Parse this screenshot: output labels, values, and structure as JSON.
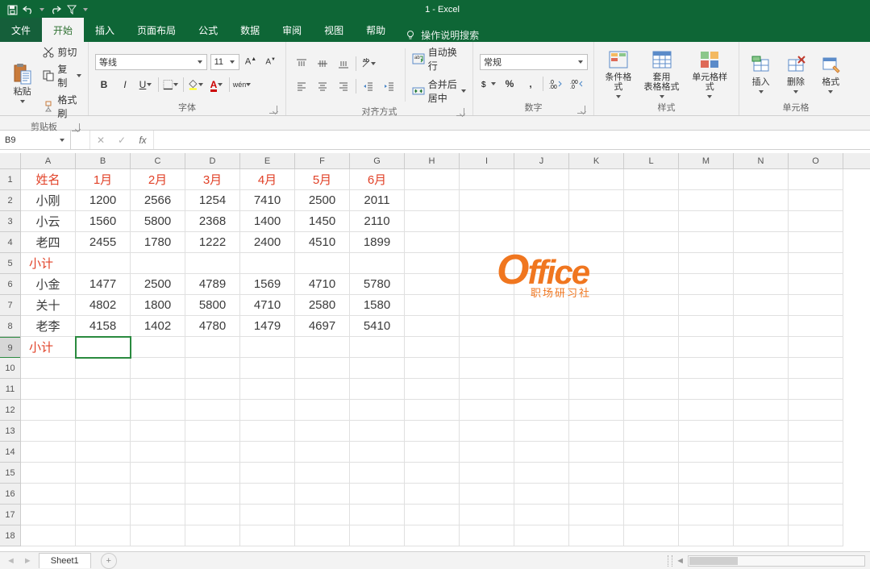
{
  "app": {
    "title": "1  -  Excel"
  },
  "qat": {
    "save": "save-icon",
    "undo": "undo-icon",
    "redo": "redo-icon",
    "filter": "funnel-icon"
  },
  "tabs": {
    "file": "文件",
    "home": "开始",
    "insert": "插入",
    "layout": "页面布局",
    "formulas": "公式",
    "data": "数据",
    "review": "审阅",
    "view": "视图",
    "help": "帮助",
    "tellme": "操作说明搜索"
  },
  "ribbon": {
    "clipboard": {
      "paste": "粘贴",
      "cut": "剪切",
      "copy": "复制",
      "painter": "格式刷",
      "label": "剪贴板"
    },
    "font": {
      "name": "等线",
      "size": "11",
      "label": "字体"
    },
    "align": {
      "wrap": "自动换行",
      "merge": "合并后居中",
      "label": "对齐方式"
    },
    "number": {
      "format": "常规",
      "label": "数字"
    },
    "styles": {
      "cond": "条件格式",
      "table": "套用\n表格格式",
      "cell": "单元格样式",
      "label": "样式"
    },
    "cells": {
      "insert": "插入",
      "delete": "删除",
      "format": "格式",
      "label": "单元格"
    }
  },
  "namebox": "B9",
  "columns": [
    "A",
    "B",
    "C",
    "D",
    "E",
    "F",
    "G",
    "H",
    "I",
    "J",
    "K",
    "L",
    "M",
    "N",
    "O"
  ],
  "row_numbers": [
    1,
    2,
    3,
    4,
    5,
    6,
    7,
    8,
    9,
    10,
    11,
    12,
    13,
    14,
    15,
    16,
    17,
    18
  ],
  "selected_cell": "B9",
  "table": {
    "headers": [
      "姓名",
      "1月",
      "2月",
      "3月",
      "4月",
      "5月",
      "6月"
    ],
    "rows": [
      [
        "小刚",
        1200,
        2566,
        1254,
        7410,
        2500,
        2011
      ],
      [
        "小云",
        1560,
        5800,
        2368,
        1400,
        1450,
        2110
      ],
      [
        "老四",
        2455,
        1780,
        1222,
        2400,
        4510,
        1899
      ],
      [
        "小计",
        "",
        "",
        "",
        "",
        "",
        ""
      ],
      [
        "小金",
        1477,
        2500,
        4789,
        1569,
        4710,
        5780
      ],
      [
        "关十",
        4802,
        1800,
        5800,
        4710,
        2580,
        1580
      ],
      [
        "老李",
        4158,
        1402,
        4780,
        1479,
        4697,
        5410
      ],
      [
        "小计",
        "",
        "",
        "",
        "",
        "",
        ""
      ]
    ],
    "subtotal_rows": [
      3,
      7
    ]
  },
  "sheet": {
    "name": "Sheet1"
  },
  "watermark": {
    "big": "Office",
    "small": "职场研习社"
  },
  "chart_data": {
    "type": "table",
    "title": "",
    "columns": [
      "姓名",
      "1月",
      "2月",
      "3月",
      "4月",
      "5月",
      "6月"
    ],
    "rows": [
      {
        "姓名": "小刚",
        "1月": 1200,
        "2月": 2566,
        "3月": 1254,
        "4月": 7410,
        "5月": 2500,
        "6月": 2011
      },
      {
        "姓名": "小云",
        "1月": 1560,
        "2月": 5800,
        "3月": 2368,
        "4月": 1400,
        "5月": 1450,
        "6月": 2110
      },
      {
        "姓名": "老四",
        "1月": 2455,
        "2月": 1780,
        "3月": 1222,
        "4月": 2400,
        "5月": 4510,
        "6月": 1899
      },
      {
        "姓名": "小金",
        "1月": 1477,
        "2月": 2500,
        "3月": 4789,
        "4月": 1569,
        "5月": 4710,
        "6月": 5780
      },
      {
        "姓名": "关十",
        "1月": 4802,
        "2月": 1800,
        "3月": 5800,
        "4月": 4710,
        "5月": 2580,
        "6月": 1580
      },
      {
        "姓名": "老李",
        "1月": 4158,
        "2月": 1402,
        "3月": 4780,
        "4月": 1479,
        "5月": 4697,
        "6月": 5410
      }
    ]
  }
}
